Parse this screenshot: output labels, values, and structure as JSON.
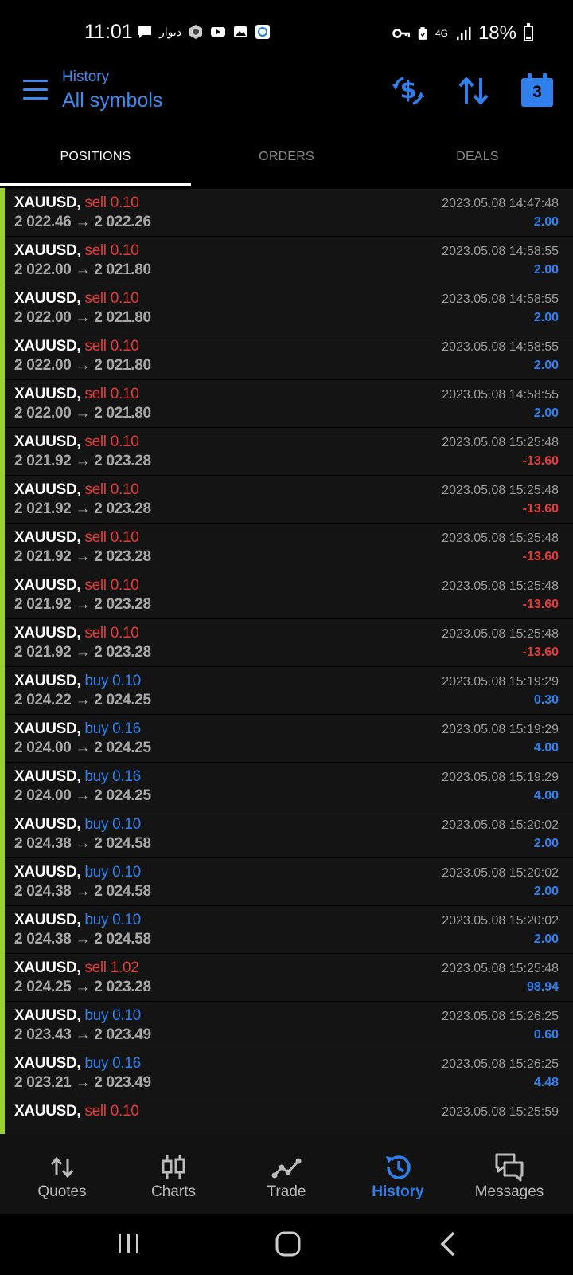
{
  "status_bar": {
    "time": "11:01",
    "notification_text": "دیوار",
    "network": "4G",
    "battery": "18%",
    "battery_level": 0.18
  },
  "header": {
    "subtitle": "History",
    "title": "All symbols",
    "calendar_badge": "3"
  },
  "tabs": [
    {
      "label": "POSITIONS",
      "active": true
    },
    {
      "label": "ORDERS",
      "active": false
    },
    {
      "label": "DEALS",
      "active": false
    }
  ],
  "colors": {
    "accent": "#3d8bef",
    "buy": "#2f80ed",
    "sell": "#e53935",
    "row_marker": "#9ad12a"
  },
  "positions": [
    {
      "symbol": "XAUUSD,",
      "side": "sell 0.10",
      "prices": "2 022.46 → 2 022.26",
      "time": "2023.05.08 14:47:48",
      "profit": "2.00"
    },
    {
      "symbol": "XAUUSD,",
      "side": "sell 0.10",
      "prices": "2 022.00 → 2 021.80",
      "time": "2023.05.08 14:58:55",
      "profit": "2.00"
    },
    {
      "symbol": "XAUUSD,",
      "side": "sell 0.10",
      "prices": "2 022.00 → 2 021.80",
      "time": "2023.05.08 14:58:55",
      "profit": "2.00"
    },
    {
      "symbol": "XAUUSD,",
      "side": "sell 0.10",
      "prices": "2 022.00 → 2 021.80",
      "time": "2023.05.08 14:58:55",
      "profit": "2.00"
    },
    {
      "symbol": "XAUUSD,",
      "side": "sell 0.10",
      "prices": "2 022.00 → 2 021.80",
      "time": "2023.05.08 14:58:55",
      "profit": "2.00"
    },
    {
      "symbol": "XAUUSD,",
      "side": "sell 0.10",
      "prices": "2 021.92 → 2 023.28",
      "time": "2023.05.08 15:25:48",
      "profit": "-13.60"
    },
    {
      "symbol": "XAUUSD,",
      "side": "sell 0.10",
      "prices": "2 021.92 → 2 023.28",
      "time": "2023.05.08 15:25:48",
      "profit": "-13.60"
    },
    {
      "symbol": "XAUUSD,",
      "side": "sell 0.10",
      "prices": "2 021.92 → 2 023.28",
      "time": "2023.05.08 15:25:48",
      "profit": "-13.60"
    },
    {
      "symbol": "XAUUSD,",
      "side": "sell 0.10",
      "prices": "2 021.92 → 2 023.28",
      "time": "2023.05.08 15:25:48",
      "profit": "-13.60"
    },
    {
      "symbol": "XAUUSD,",
      "side": "sell 0.10",
      "prices": "2 021.92 → 2 023.28",
      "time": "2023.05.08 15:25:48",
      "profit": "-13.60"
    },
    {
      "symbol": "XAUUSD,",
      "side": "buy 0.10",
      "prices": "2 024.22 → 2 024.25",
      "time": "2023.05.08 15:19:29",
      "profit": "0.30"
    },
    {
      "symbol": "XAUUSD,",
      "side": "buy 0.16",
      "prices": "2 024.00 → 2 024.25",
      "time": "2023.05.08 15:19:29",
      "profit": "4.00"
    },
    {
      "symbol": "XAUUSD,",
      "side": "buy 0.16",
      "prices": "2 024.00 → 2 024.25",
      "time": "2023.05.08 15:19:29",
      "profit": "4.00"
    },
    {
      "symbol": "XAUUSD,",
      "side": "buy 0.10",
      "prices": "2 024.38 → 2 024.58",
      "time": "2023.05.08 15:20:02",
      "profit": "2.00"
    },
    {
      "symbol": "XAUUSD,",
      "side": "buy 0.10",
      "prices": "2 024.38 → 2 024.58",
      "time": "2023.05.08 15:20:02",
      "profit": "2.00"
    },
    {
      "symbol": "XAUUSD,",
      "side": "buy 0.10",
      "prices": "2 024.38 → 2 024.58",
      "time": "2023.05.08 15:20:02",
      "profit": "2.00"
    },
    {
      "symbol": "XAUUSD,",
      "side": "sell 1.02",
      "prices": "2 024.25 → 2 023.28",
      "time": "2023.05.08 15:25:48",
      "profit": "98.94"
    },
    {
      "symbol": "XAUUSD,",
      "side": "buy 0.10",
      "prices": "2 023.43 → 2 023.49",
      "time": "2023.05.08 15:26:25",
      "profit": "0.60"
    },
    {
      "symbol": "XAUUSD,",
      "side": "buy 0.16",
      "prices": "2 023.21 → 2 023.49",
      "time": "2023.05.08 15:26:25",
      "profit": "4.48"
    },
    {
      "symbol": "XAUUSD,",
      "side": "sell 0.10",
      "prices": "",
      "time": "2023.05.08 15:25:59",
      "profit": ""
    }
  ],
  "bottom_nav": [
    {
      "label": "Quotes",
      "icon": "quotes-arrows-icon",
      "active": false
    },
    {
      "label": "Charts",
      "icon": "candlestick-icon",
      "active": false
    },
    {
      "label": "Trade",
      "icon": "trade-line-icon",
      "active": false
    },
    {
      "label": "History",
      "icon": "history-clock-icon",
      "active": true
    },
    {
      "label": "Messages",
      "icon": "chat-bubbles-icon",
      "active": false
    }
  ]
}
